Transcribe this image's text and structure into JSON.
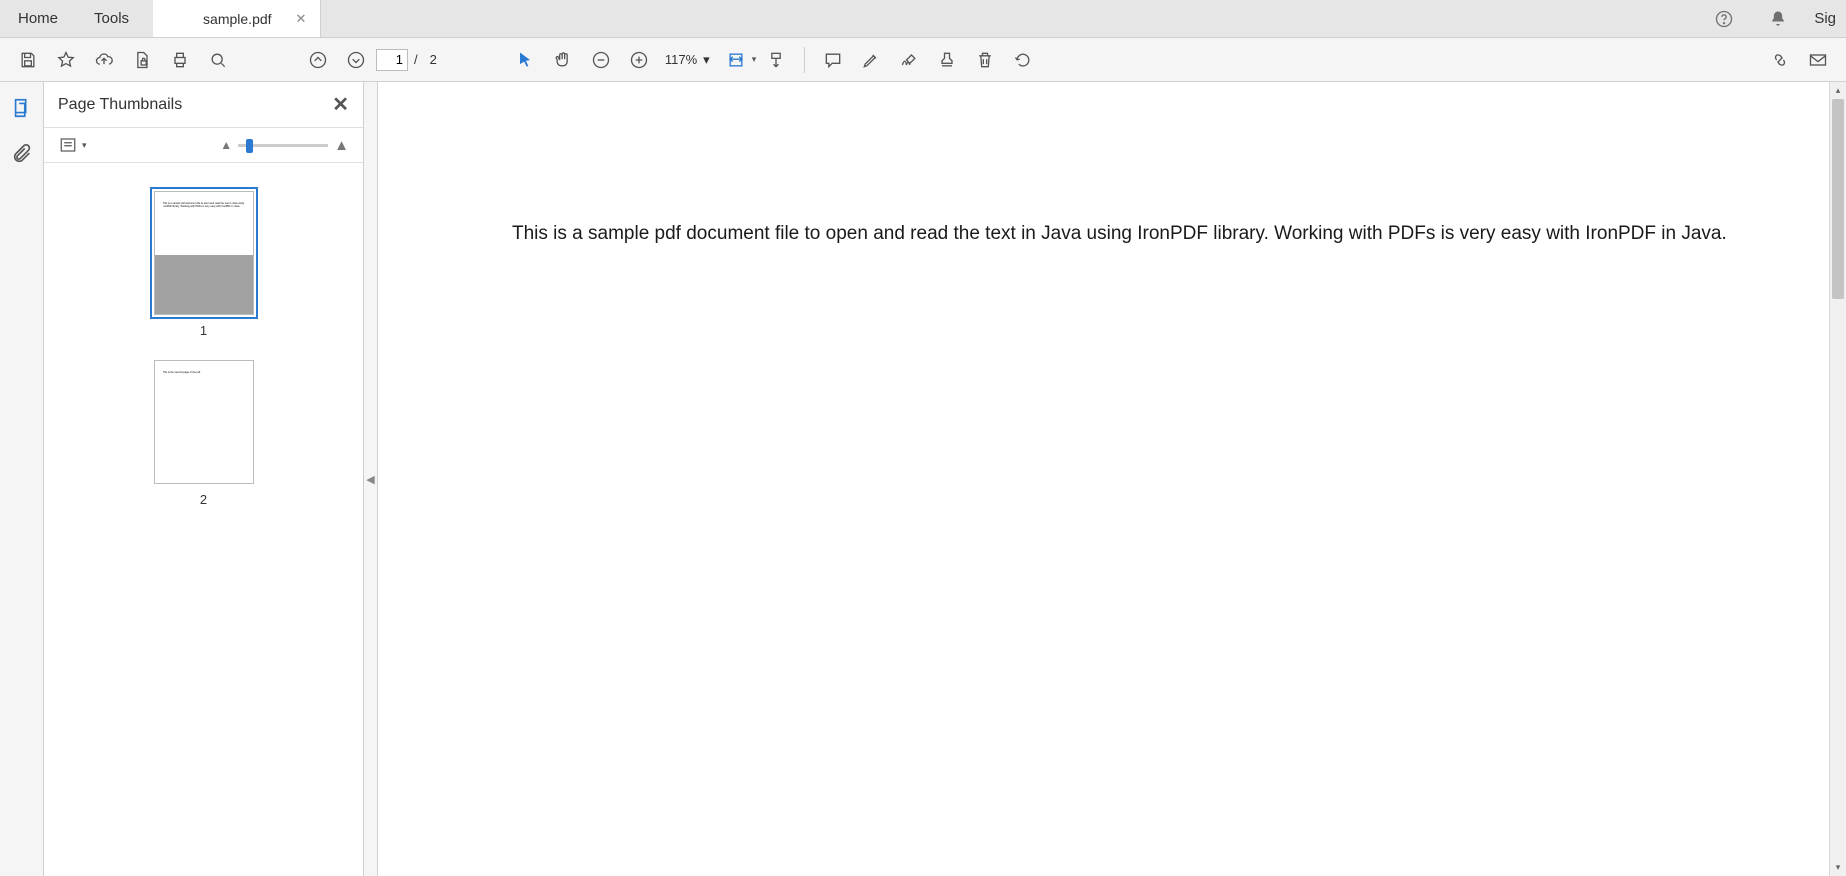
{
  "tabs": {
    "home": "Home",
    "tools": "Tools",
    "file": "sample.pdf",
    "signin": "Sig"
  },
  "toolbar": {
    "current_page": "1",
    "page_sep": "/",
    "total_pages": "2",
    "zoom": "117%"
  },
  "thumbnails": {
    "title": "Page Thumbnails",
    "pages": [
      {
        "num": "1",
        "selected": true,
        "preview": "This is a sample pdf document file to open and read the text in Java using IronPDF library. Working with PDFs is very easy with IronPDF in Java."
      },
      {
        "num": "2",
        "selected": false,
        "preview": "This is the second page of the pdf."
      }
    ]
  },
  "document": {
    "text": "This is a sample pdf document file to open and read the text in Java using IronPDF library. Working with PDFs is very easy with IronPDF in Java."
  }
}
